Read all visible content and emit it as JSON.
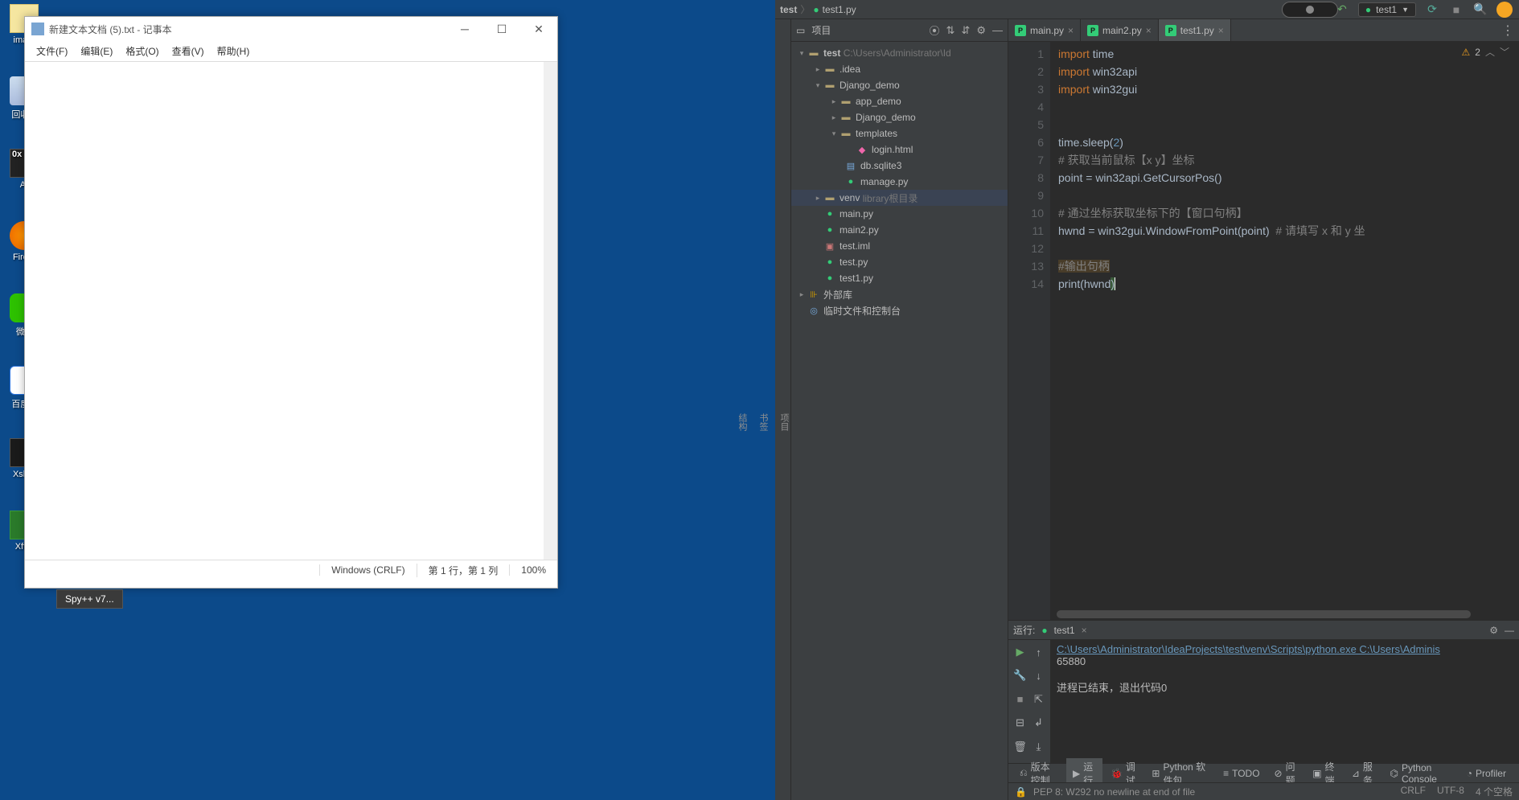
{
  "desktop": {
    "icons": [
      {
        "label": "ima...",
        "name": "desktop-icon-ima"
      },
      {
        "label": "回收...",
        "name": "desktop-icon-recycle"
      },
      {
        "label": "AI",
        "name": "desktop-icon-ai"
      },
      {
        "label": "Fire...",
        "name": "desktop-icon-firefox"
      },
      {
        "label": "微...",
        "name": "desktop-icon-wechat"
      },
      {
        "label": "百度...",
        "name": "desktop-icon-baidu"
      },
      {
        "label": "Xsh...",
        "name": "desktop-icon-xshell"
      },
      {
        "label": "Xft...",
        "name": "desktop-icon-xftp"
      }
    ]
  },
  "notepad": {
    "title": "新建文本文档 (5).txt - 记事本",
    "menu": {
      "file": "文件(F)",
      "edit": "编辑(E)",
      "format": "格式(O)",
      "view": "查看(V)",
      "help": "帮助(H)"
    },
    "status": {
      "encoding": "Windows (CRLF)",
      "position": "第 1 行，第 1 列",
      "zoom": "100%"
    }
  },
  "spy_button": "Spy++ v7...",
  "pycharm": {
    "breadcrumb": {
      "root": "test",
      "file": "test1.py"
    },
    "run_config": "test1",
    "project_panel": {
      "title": "项目",
      "root": {
        "name": "test",
        "path": "C:\\Users\\Administrator\\Id"
      },
      "items": {
        "idea": ".idea",
        "django_demo": "Django_demo",
        "app_demo": "app_demo",
        "django_demo2": "Django_demo",
        "templates": "templates",
        "login_html": "login.html",
        "db_sqlite": "db.sqlite3",
        "manage_py": "manage.py",
        "venv": "venv",
        "venv_hint": "library根目录",
        "main_py": "main.py",
        "main2_py": "main2.py",
        "test_iml": "test.iml",
        "test_py": "test.py",
        "test1_py": "test1.py",
        "ext_libs": "外部库",
        "temp_console": "临时文件和控制台"
      }
    },
    "tabs": {
      "main": "main.py",
      "main2": "main2.py",
      "test1": "test1.py"
    },
    "editor": {
      "line_numbers": [
        "1",
        "2",
        "3",
        "4",
        "5",
        "6",
        "7",
        "8",
        "9",
        "10",
        "11",
        "12",
        "13",
        "14"
      ],
      "warn_count": "2",
      "tokens": {
        "l1a": "import",
        "l1b": "time",
        "l2a": "import",
        "l2b": "win32api",
        "l3a": "import",
        "l3b": "win32gui",
        "l6": "time.sleep(",
        "l6n": "2",
        "l6c": ")",
        "l7": "# 获取当前鼠标【x y】坐标",
        "l8": "point = win32api.GetCursorPos()",
        "l10": "# 通过坐标获取坐标下的【窗口句柄】",
        "l11a": "hwnd = win32gui.WindowFromPoint(point)  ",
        "l11b": "# 请填写 x 和 y 坐",
        "l13": "#输出句柄",
        "l14a": "print",
        "l14b": "(hwnd",
        "l14c": ")"
      }
    },
    "run_panel": {
      "label": "运行:",
      "name": "test1",
      "output_path": "C:\\Users\\Administrator\\IdeaProjects\\test\\venv\\Scripts\\python.exe  C:\\Users\\Adminis",
      "output_value": "65880",
      "exit_msg": "进程已结束，退出代码0"
    },
    "bottom_toolbar": {
      "version_control": "版本控制",
      "run": "运行",
      "debug": "调试",
      "python_pkg": "Python 软件包",
      "todo": "TODO",
      "problems": "问题",
      "terminal": "终端",
      "services": "服务",
      "python_console": "Python Console",
      "profiler": "Profiler"
    },
    "status": {
      "pep8": "PEP 8: W292 no newline at end of file",
      "line_sep": "CRLF",
      "encoding": "UTF-8",
      "indent": "4 个空格"
    }
  }
}
